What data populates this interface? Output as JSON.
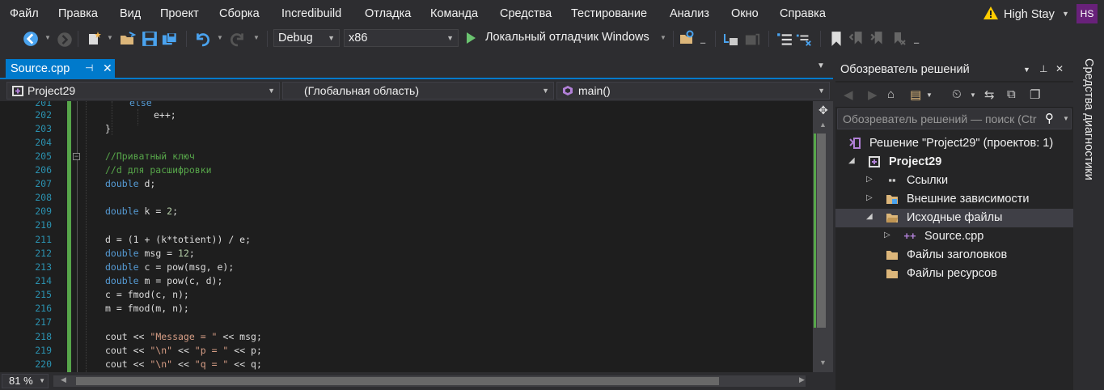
{
  "menu": [
    "Файл",
    "Правка",
    "Вид",
    "Проект",
    "Сборка",
    "Incredibuild",
    "Отладка",
    "Команда",
    "Средства",
    "Тестирование",
    "Анализ",
    "Окно",
    "Справка"
  ],
  "user": {
    "name": "High Stay",
    "initials": "HS",
    "avatar_color": "#68217a"
  },
  "toolbar": {
    "configuration": "Debug",
    "platform": "x86",
    "run_label": "Локальный отладчик Windows"
  },
  "editor": {
    "tab_label": "Source.cpp",
    "nav_project": "Project29",
    "nav_scope": "(Глобальная область)",
    "nav_member": "main()",
    "zoom": "81 %",
    "lines": [
      {
        "n": "201",
        "text": "else"
      },
      {
        "n": "202",
        "text": "e++;"
      },
      {
        "n": "203",
        "text": "}"
      },
      {
        "n": "204",
        "text": ""
      },
      {
        "n": "205",
        "text": "//Приватный ключ"
      },
      {
        "n": "206",
        "text": "//d для расшифровки"
      },
      {
        "n": "207",
        "kw": "double",
        "text": " d;"
      },
      {
        "n": "208",
        "text": ""
      },
      {
        "n": "209",
        "kw": "double",
        "text": " k = ",
        "num": "2",
        "tail": ";"
      },
      {
        "n": "210",
        "text": ""
      },
      {
        "n": "211",
        "text": "d = (1 + (k*totient)) / e;"
      },
      {
        "n": "212",
        "kw": "double",
        "text": " msg = ",
        "num": "12",
        "tail": ";"
      },
      {
        "n": "213",
        "kw": "double",
        "text": " c = pow(msg, e);"
      },
      {
        "n": "214",
        "kw": "double",
        "text": " m = pow(c, d);"
      },
      {
        "n": "215",
        "text": "c = fmod(c, n);"
      },
      {
        "n": "216",
        "text": "m = fmod(m, n);"
      },
      {
        "n": "217",
        "text": ""
      },
      {
        "n": "218",
        "text": "cout << ",
        "str": "\"Message = \"",
        "tail": " << msg;"
      },
      {
        "n": "219",
        "text": "cout << ",
        "str": "\"\\n\"",
        "mid": " << ",
        "str2": "\"p = \"",
        "tail": " << p;"
      },
      {
        "n": "220",
        "text": "cout << ",
        "str": "\"\\n\"",
        "mid": " << ",
        "str2": "\"q = \"",
        "tail": " << q;"
      }
    ]
  },
  "solution_explorer": {
    "title": "Обозреватель решений",
    "search_placeholder": "Обозреватель решений — поиск (Ctrl+;)",
    "items": [
      {
        "label": "Решение \"Project29\"  (проектов: 1)"
      },
      {
        "label": "Project29"
      },
      {
        "label": "Ссылки"
      },
      {
        "label": "Внешние зависимости"
      },
      {
        "label": "Исходные файлы"
      },
      {
        "label": "Source.cpp"
      },
      {
        "label": "Файлы заголовков"
      },
      {
        "label": "Файлы ресурсов"
      }
    ]
  },
  "side_tab": "Средства диагностики",
  "colors": {
    "accent": "#007acc",
    "keyword": "#569cd6",
    "comment": "#57a64a",
    "string": "#d69d85",
    "line_number": "#2b91af"
  }
}
